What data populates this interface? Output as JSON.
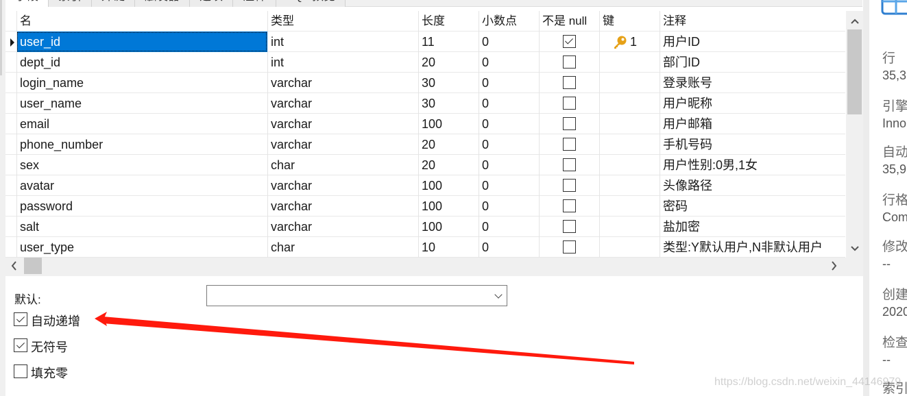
{
  "tabs": [
    {
      "label": "字段",
      "active": true
    },
    {
      "label": "索引",
      "active": false
    },
    {
      "label": "外键",
      "active": false
    },
    {
      "label": "触发器",
      "active": false
    },
    {
      "label": "选项",
      "active": false
    },
    {
      "label": "注释",
      "active": false
    },
    {
      "label": "SQL 预览",
      "active": false
    }
  ],
  "grid": {
    "columns": [
      "名",
      "类型",
      "长度",
      "小数点",
      "不是 null",
      "键",
      "注释"
    ],
    "rows": [
      {
        "name": "user_id",
        "type": "int",
        "length": "11",
        "decimals": "0",
        "not_null": true,
        "key": "1",
        "comment": "用户ID",
        "selected": true
      },
      {
        "name": "dept_id",
        "type": "int",
        "length": "20",
        "decimals": "0",
        "not_null": false,
        "key": "",
        "comment": "部门ID"
      },
      {
        "name": "login_name",
        "type": "varchar",
        "length": "30",
        "decimals": "0",
        "not_null": false,
        "key": "",
        "comment": "登录账号"
      },
      {
        "name": "user_name",
        "type": "varchar",
        "length": "30",
        "decimals": "0",
        "not_null": false,
        "key": "",
        "comment": "用户昵称"
      },
      {
        "name": "email",
        "type": "varchar",
        "length": "100",
        "decimals": "0",
        "not_null": false,
        "key": "",
        "comment": "用户邮箱"
      },
      {
        "name": "phone_number",
        "type": "varchar",
        "length": "20",
        "decimals": "0",
        "not_null": false,
        "key": "",
        "comment": "手机号码"
      },
      {
        "name": "sex",
        "type": "char",
        "length": "20",
        "decimals": "0",
        "not_null": false,
        "key": "",
        "comment": "用户性别:0男,1女"
      },
      {
        "name": "avatar",
        "type": "varchar",
        "length": "100",
        "decimals": "0",
        "not_null": false,
        "key": "",
        "comment": "头像路径"
      },
      {
        "name": "password",
        "type": "varchar",
        "length": "100",
        "decimals": "0",
        "not_null": false,
        "key": "",
        "comment": "密码"
      },
      {
        "name": "salt",
        "type": "varchar",
        "length": "100",
        "decimals": "0",
        "not_null": false,
        "key": "",
        "comment": "盐加密"
      },
      {
        "name": "user_type",
        "type": "char",
        "length": "10",
        "decimals": "0",
        "not_null": false,
        "key": "",
        "comment": "类型:Y默认用户,N非默认用户"
      }
    ],
    "key_icon": "primary-key-icon"
  },
  "scroll": {
    "vertical_up": "^",
    "vertical_down": "v",
    "horizontal_left": "<",
    "horizontal_right": ">"
  },
  "field_props": {
    "default_label": "默认:",
    "default_value": "",
    "options": [
      {
        "label": "自动递增",
        "checked": true
      },
      {
        "label": "无符号",
        "checked": true
      },
      {
        "label": "填充零",
        "checked": false
      }
    ]
  },
  "info_pane": {
    "items": [
      {
        "title": "行",
        "value": "35,3"
      },
      {
        "title": "引擎",
        "value": "Inno"
      },
      {
        "title": "自动",
        "value": "35,9"
      },
      {
        "title": "行格",
        "value": "Com"
      },
      {
        "title": "修改",
        "value": "--"
      },
      {
        "title": "创建",
        "value": "2020"
      },
      {
        "title": "检查",
        "value": "--"
      },
      {
        "title": "索引",
        "value": ""
      }
    ]
  },
  "annotation": {
    "color": "#ff1a0d",
    "points_to": "自动递增"
  },
  "watermark": "https://blog.csdn.net/weixin_44146979"
}
